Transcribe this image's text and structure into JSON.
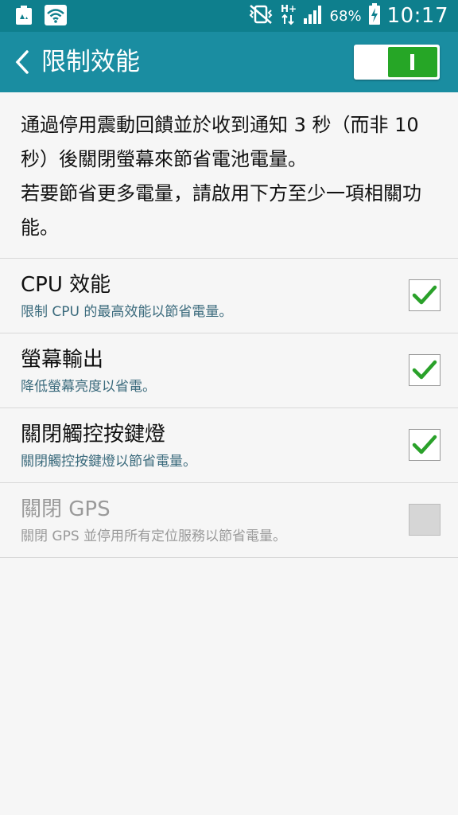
{
  "status_bar": {
    "left_icons": [
      "recycle-icon",
      "wifi-icon"
    ],
    "right_icons": [
      "mute-vibrate-icon",
      "hplus-data-icon",
      "signal-icon",
      "battery-charging-icon"
    ],
    "battery_percent": "68%",
    "time": "10:17",
    "network_label": "H+"
  },
  "app_bar": {
    "title": "限制效能",
    "master_switch_on": true,
    "colors": {
      "bar": "#1a8da1",
      "status": "#0e7f8d",
      "switch_on": "#26a626",
      "check": "#2aa12a"
    }
  },
  "description": {
    "line1": "通過停用震動回饋並於收到通知 3 秒（而非 10 秒）後關閉螢幕來節省電池電量。",
    "line2": "若要節省更多電量，請啟用下方至少一項相關功能。"
  },
  "settings": [
    {
      "title": "CPU 效能",
      "summary": "限制 CPU 的最高效能以節省電量。",
      "checked": true,
      "enabled": true
    },
    {
      "title": "螢幕輸出",
      "summary": "降低螢幕亮度以省電。",
      "checked": true,
      "enabled": true
    },
    {
      "title": "關閉觸控按鍵燈",
      "summary": "關閉觸控按鍵燈以節省電量。",
      "checked": true,
      "enabled": true
    },
    {
      "title": "關閉 GPS",
      "summary": "關閉 GPS 並停用所有定位服務以節省電量。",
      "checked": false,
      "enabled": false
    }
  ]
}
